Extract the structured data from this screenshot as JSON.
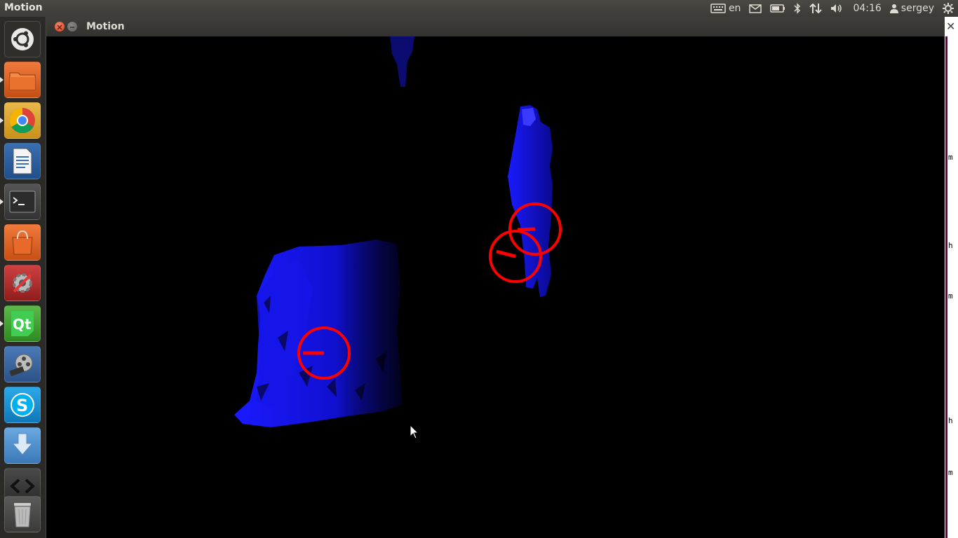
{
  "topbar": {
    "app_name": "Motion",
    "keyboard_layout": "en",
    "time": "04:16",
    "user": "sergey"
  },
  "window": {
    "title": "Motion"
  },
  "right_panel": {
    "letters": [
      "m",
      "h",
      "m",
      "h",
      "m"
    ]
  },
  "launcher": {
    "items": [
      "dash-home",
      "files",
      "chrome",
      "libreoffice-writer",
      "terminal",
      "software-center",
      "system-settings",
      "qt-creator",
      "video-editor",
      "skype",
      "downloads",
      "workspaces",
      "trash"
    ]
  },
  "colors": {
    "scene_blue": "#1a1aff",
    "marker_red": "#ff0000"
  }
}
